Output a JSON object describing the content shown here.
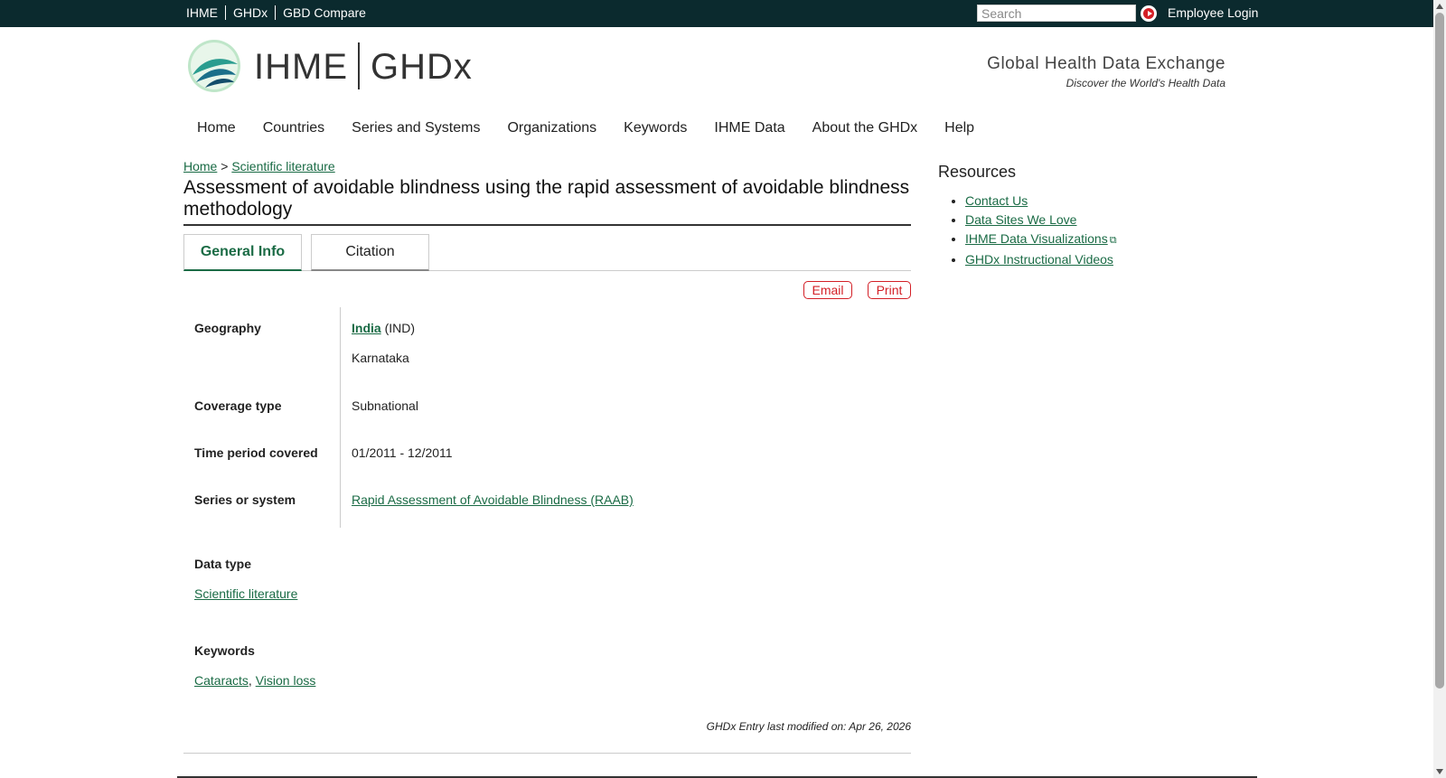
{
  "topbar": {
    "links": [
      "IHME",
      "GHDx",
      "GBD Compare"
    ],
    "search_placeholder": "Search",
    "login": "Employee Login"
  },
  "header": {
    "logo_ihme": "IHME",
    "logo_ghdx": "GHDx",
    "tagline_main": "Global Health Data Exchange",
    "tagline_sub": "Discover the World's Health Data"
  },
  "nav": [
    "Home",
    "Countries",
    "Series and Systems",
    "Organizations",
    "Keywords",
    "IHME Data",
    "About the GHDx",
    "Help"
  ],
  "breadcrumb": {
    "home": "Home",
    "sep": ">",
    "current": "Scientific literature"
  },
  "page_title": "Assessment of avoidable blindness using the rapid assessment of avoidable blindness methodology",
  "tabs": {
    "general": "General Info",
    "citation": "Citation"
  },
  "actions": {
    "email": "Email",
    "print": "Print"
  },
  "fields": {
    "geography": {
      "label": "Geography",
      "country": "India",
      "country_code": "(IND)",
      "region": "Karnataka"
    },
    "coverage": {
      "label": "Coverage type",
      "value": "Subnational"
    },
    "time": {
      "label": "Time period covered",
      "value": "01/2011 - 12/2011"
    },
    "series": {
      "label": "Series or system",
      "value": "Rapid Assessment of Avoidable Blindness (RAAB)"
    }
  },
  "data_type": {
    "label": "Data type",
    "value": "Scientific literature"
  },
  "keywords": {
    "label": "Keywords",
    "items": [
      "Cataracts",
      "Vision loss"
    ],
    "sep": ","
  },
  "modified": "GHDx Entry last modified on: Apr 26, 2026",
  "resources": {
    "title": "Resources",
    "items": [
      "Contact Us",
      "Data Sites We Love",
      "IHME Data Visualizations",
      "GHDx Instructional Videos"
    ]
  },
  "colors": {
    "topbar": "#0b2a2e",
    "link": "#1a6b45",
    "accent_red": "#d31f26"
  }
}
